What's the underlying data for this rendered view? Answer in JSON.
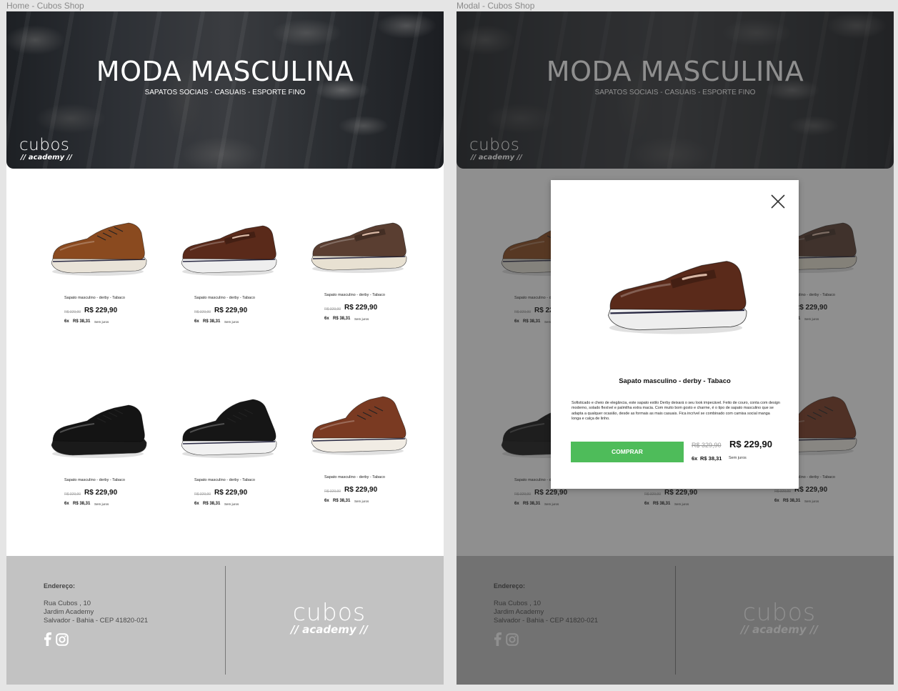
{
  "frames": {
    "home_label": "Home - Cubos Shop",
    "modal_label": "Modal - Cubos Shop"
  },
  "hero": {
    "title": "MODA MASCULINA",
    "subtitle": "SAPATOS SOCIAIS - CASUAIS - ESPORTE FINO",
    "logo_word": "cubos",
    "logo_sub": "// academy //"
  },
  "products": [
    {
      "name": "Sapato masculino - derby - Tabaco",
      "old_price": "R$ 329,90",
      "price": "R$ 229,90",
      "installments": "6x",
      "installment_value": "R$ 38,31",
      "interest": "Sem juros",
      "color": "#8a4a1f",
      "sole": "#e9e3d8",
      "style": "derby"
    },
    {
      "name": "Sapato masculino - derby - Tabaco",
      "old_price": "R$ 329,90",
      "price": "R$ 229,90",
      "installments": "6x",
      "installment_value": "R$ 38,31",
      "interest": "Sem juros",
      "color": "#5a2a1a",
      "sole": "#eeeeee",
      "style": "loafer"
    },
    {
      "name": "Sapato masculino - derby - Tabaco",
      "old_price": "R$ 329,90",
      "price": "R$ 229,90",
      "installments": "6x",
      "installment_value": "R$ 38,31",
      "interest": "Sem juros",
      "color": "#5a3e31",
      "sole": "#e8e1d2",
      "style": "loafer"
    },
    {
      "name": "Sapato masculino - derby - Tabaco",
      "old_price": "R$ 329,90",
      "price": "R$ 229,90",
      "installments": "6x",
      "installment_value": "R$ 38,31",
      "interest": "Sem juros",
      "color": "#141414",
      "sole": "#1a1a1a",
      "style": "derby"
    },
    {
      "name": "Sapato masculino - derby - Tabaco",
      "old_price": "R$ 329,90",
      "price": "R$ 229,90",
      "installments": "6x",
      "installment_value": "R$ 38,31",
      "interest": "Sem juros",
      "color": "#161616",
      "sole": "#f1f1f1",
      "style": "sneaker"
    },
    {
      "name": "Sapato masculino - derby - Tabaco",
      "old_price": "R$ 329,90",
      "price": "R$ 229,90",
      "installments": "6x",
      "installment_value": "R$ 38,31",
      "interest": "Sem juros",
      "color": "#7a3a22",
      "sole": "#f1ece4",
      "style": "sneaker"
    }
  ],
  "footer": {
    "address_label": "Endereço:",
    "address_lines": [
      "Rua Cubos ,  10",
      "Jardim Academy",
      "Salvador - Bahia - CEP 41820-021"
    ],
    "logo_word": "cubos",
    "logo_sub": "// academy //"
  },
  "modal": {
    "title": "Sapato masculino - derby - Tabaco",
    "description": "Sofisticado e cheio de elegância, este sapato estilo Derby deixará o seu look impecável. Feito de couro, conta com design moderno, solado flexível e palmilha extra macia. Com muito bom gosto e charme, é o tipo de sapato masculino que se adapta a qualquer ocasião, desde as formais as mais casuais. Fica incrível se combinado com camisa social manga longa e calça de linho.",
    "buy_label": "COMPRAR",
    "old_price": "R$ 329,90",
    "price": "R$ 229,90",
    "installments": "6x",
    "installment_value": "R$ 38,31",
    "interest": "Sem juros",
    "shoe_color": "#5a2a1a"
  },
  "colors": {
    "buy_button": "#4ebc5a",
    "footer_bg": "#c2c2c2"
  }
}
